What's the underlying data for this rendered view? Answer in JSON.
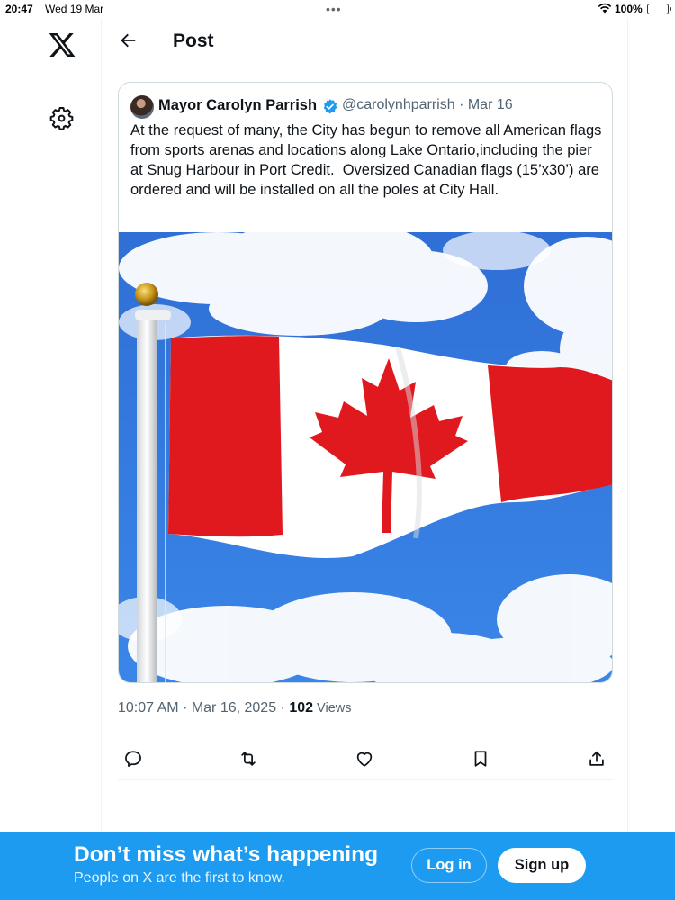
{
  "status_bar": {
    "time": "20:47",
    "date": "Wed 19 Mar",
    "battery": "100%"
  },
  "rail": {
    "logo_icon": "x-logo-icon",
    "settings_icon": "gear-icon"
  },
  "header": {
    "back_icon": "arrow-left-icon",
    "title": "Post"
  },
  "quoted_post": {
    "author_name": "Mayor Carolyn Parrish",
    "verified": true,
    "handle_date": "@carolynhparrish · Mar 16",
    "text": "At the request of many, the City has begun to remove all American flags from sports arenas and locations along Lake Ontario,including the pier at Snug Harbour in Port Credit.  Oversized Canadian flags (15’x30’) are ordered and will be installed on all the poles at City Hall.",
    "image": "canadian-flag-photo"
  },
  "post_meta": {
    "timestamp": "10:07 AM · Mar 16, 2025 · ",
    "views_count": "102",
    "views_label": " Views"
  },
  "actions": [
    {
      "icon": "reply-icon"
    },
    {
      "icon": "repost-icon"
    },
    {
      "icon": "like-icon"
    },
    {
      "icon": "bookmark-icon"
    },
    {
      "icon": "share-icon"
    }
  ],
  "banner": {
    "headline": "Don’t miss what’s happening",
    "subtext": "People on X are the first to know.",
    "login_label": "Log in",
    "signup_label": "Sign up"
  },
  "colors": {
    "brand_blue": "#1d9bf0",
    "text_primary": "#0f1419",
    "text_secondary": "#536471",
    "flag_red": "#e0191f"
  }
}
